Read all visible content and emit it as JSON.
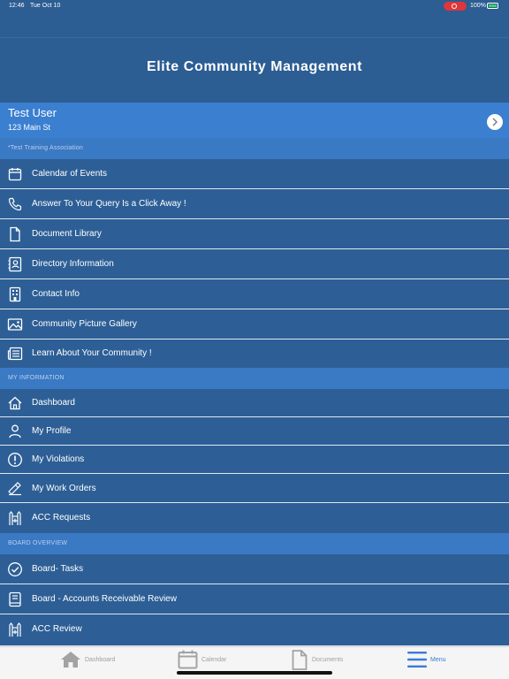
{
  "status": {
    "time": "12:46",
    "date": "Tue Oct 10",
    "battery": "100%"
  },
  "header": {
    "title": "Elite Community Management"
  },
  "user": {
    "name": "Test User",
    "address": "123 Main St",
    "association": "*Test Training Association"
  },
  "menu": [
    {
      "label": "Calendar of Events",
      "icon": "calendar-icon"
    },
    {
      "label": "Answer To Your Query Is a Click Away !",
      "icon": "phone-icon"
    },
    {
      "label": "Document Library",
      "icon": "document-icon"
    },
    {
      "label": "Directory Information",
      "icon": "contact-card-icon"
    },
    {
      "label": "Contact Info",
      "icon": "building-icon"
    },
    {
      "label": "Community Picture Gallery",
      "icon": "image-icon"
    },
    {
      "label": "Learn About Your Community !",
      "icon": "newspaper-icon"
    }
  ],
  "my_information": {
    "header": "MY INFORMATION",
    "items": [
      {
        "label": "Dashboard",
        "icon": "home-icon"
      },
      {
        "label": "My Profile",
        "icon": "person-icon"
      },
      {
        "label": "My Violations",
        "icon": "alert-circle-icon"
      },
      {
        "label": "My Work Orders",
        "icon": "hammer-icon"
      },
      {
        "label": "ACC Requests",
        "icon": "fence-icon"
      }
    ]
  },
  "board_overview": {
    "header": "BOARD OVERVIEW",
    "items": [
      {
        "label": "Board- Tasks",
        "icon": "check-circle-icon"
      },
      {
        "label": "Board - Accounts Receivable Review",
        "icon": "ledger-icon"
      },
      {
        "label": "ACC Review",
        "icon": "fence-icon"
      }
    ]
  },
  "tabs": [
    {
      "label": "Dashboard",
      "icon": "home-icon",
      "active": false
    },
    {
      "label": "Calendar",
      "icon": "calendar-icon",
      "active": false
    },
    {
      "label": "Documents",
      "icon": "document-icon",
      "active": false
    },
    {
      "label": "Menu",
      "icon": "menu-icon",
      "active": true
    }
  ],
  "colors": {
    "header_bg": "#2c5d93",
    "user_bg": "#3b7fd0",
    "section_bg": "#3a79c4",
    "row_bg": "#2d5f96",
    "tab_active": "#3a7bd5"
  }
}
